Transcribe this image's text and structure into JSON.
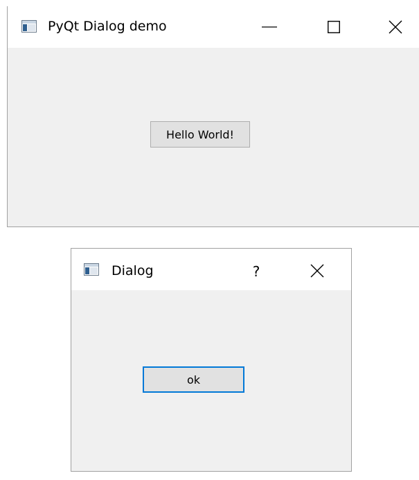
{
  "main_window": {
    "title": "PyQt Dialog demo",
    "icon": "app-window-icon",
    "controls": {
      "minimize": "minimize-icon",
      "maximize": "maximize-icon",
      "close": "close-icon"
    },
    "button_label": "Hello World!"
  },
  "dialog": {
    "title": "Dialog",
    "icon": "app-window-icon",
    "help_label": "?",
    "controls": {
      "close": "close-icon"
    },
    "ok_label": "ok",
    "focus_color": "#0078d7"
  },
  "colors": {
    "window_bg": "#f0f0f0",
    "titlebar_bg": "#ffffff",
    "button_bg": "#e1e1e1",
    "button_border": "#adadad"
  }
}
